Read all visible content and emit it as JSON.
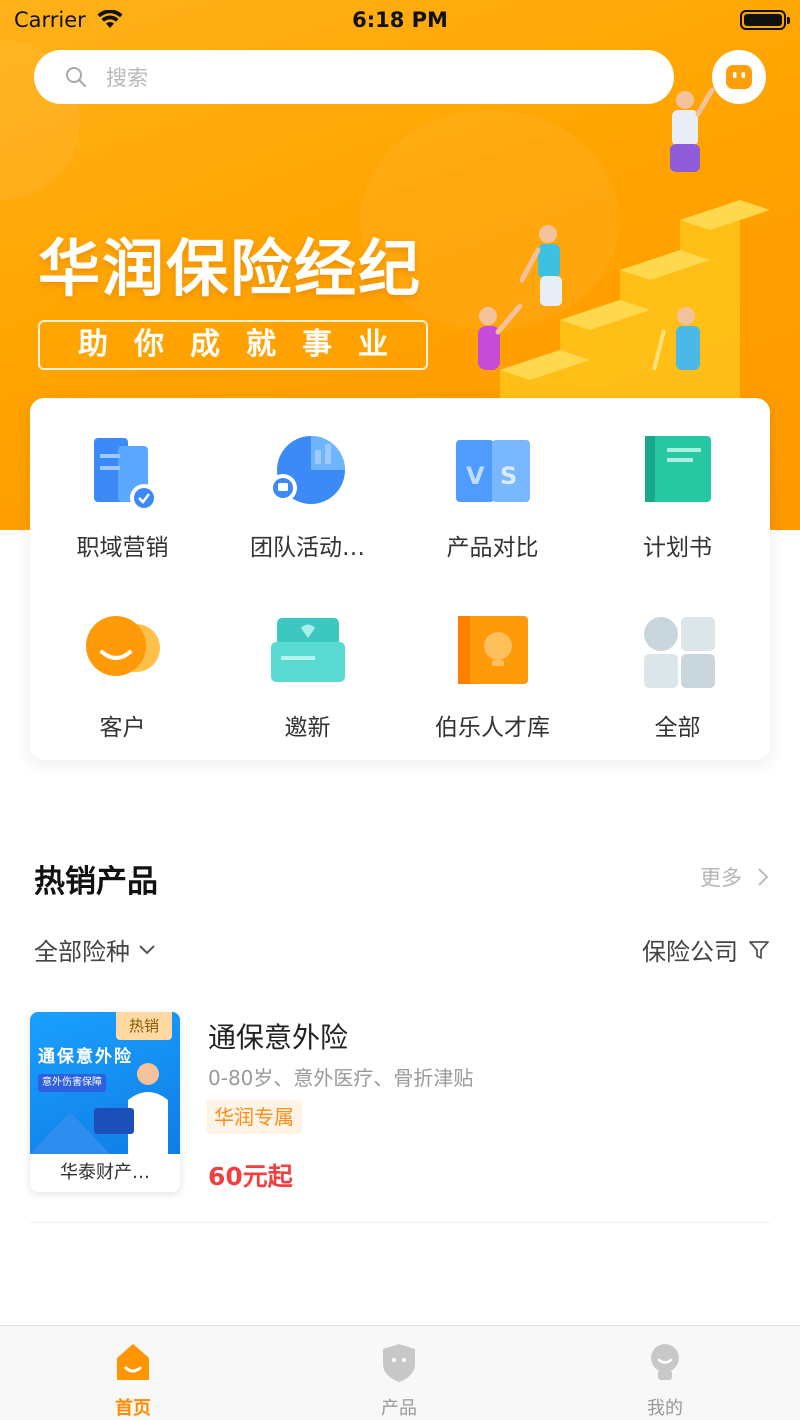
{
  "status_bar": {
    "carrier": "Carrier",
    "time": "6:18 PM"
  },
  "search": {
    "placeholder": "搜索"
  },
  "banner": {
    "title": "华润保险经纪",
    "slogan": "助你成就事业"
  },
  "quick_menu": {
    "items": [
      {
        "label": "职域营销",
        "icon": "workplace-marketing-icon"
      },
      {
        "label": "团队活动…",
        "icon": "team-activity-icon"
      },
      {
        "label": "产品对比",
        "icon": "product-compare-icon"
      },
      {
        "label": "计划书",
        "icon": "plan-book-icon"
      },
      {
        "label": "客户",
        "icon": "customer-icon"
      },
      {
        "label": "邀新",
        "icon": "invite-icon"
      },
      {
        "label": "伯乐人才库",
        "icon": "talent-pool-icon"
      },
      {
        "label": "全部",
        "icon": "all-apps-icon"
      }
    ]
  },
  "hot_products": {
    "title": "热销产品",
    "more": "更多",
    "filter_left": "全部险种",
    "filter_right": "保险公司",
    "items": [
      {
        "thumb_title": "通保意外险",
        "thumb_subtitle": "意外伤害保障",
        "badge": "热销",
        "company": "华泰财产…",
        "name": "通保意外险",
        "desc": "0-80岁、意外医疗、骨折津贴",
        "tag": "华润专属",
        "price": "60元起"
      }
    ]
  },
  "tabbar": {
    "items": [
      {
        "label": "首页",
        "active": true
      },
      {
        "label": "产品",
        "active": false
      },
      {
        "label": "我的",
        "active": false
      }
    ]
  },
  "colors": {
    "brand": "#ffa400",
    "accent_tag": "#ff8c1a",
    "price": "#f04040",
    "tab_active": "#ff8c00"
  }
}
